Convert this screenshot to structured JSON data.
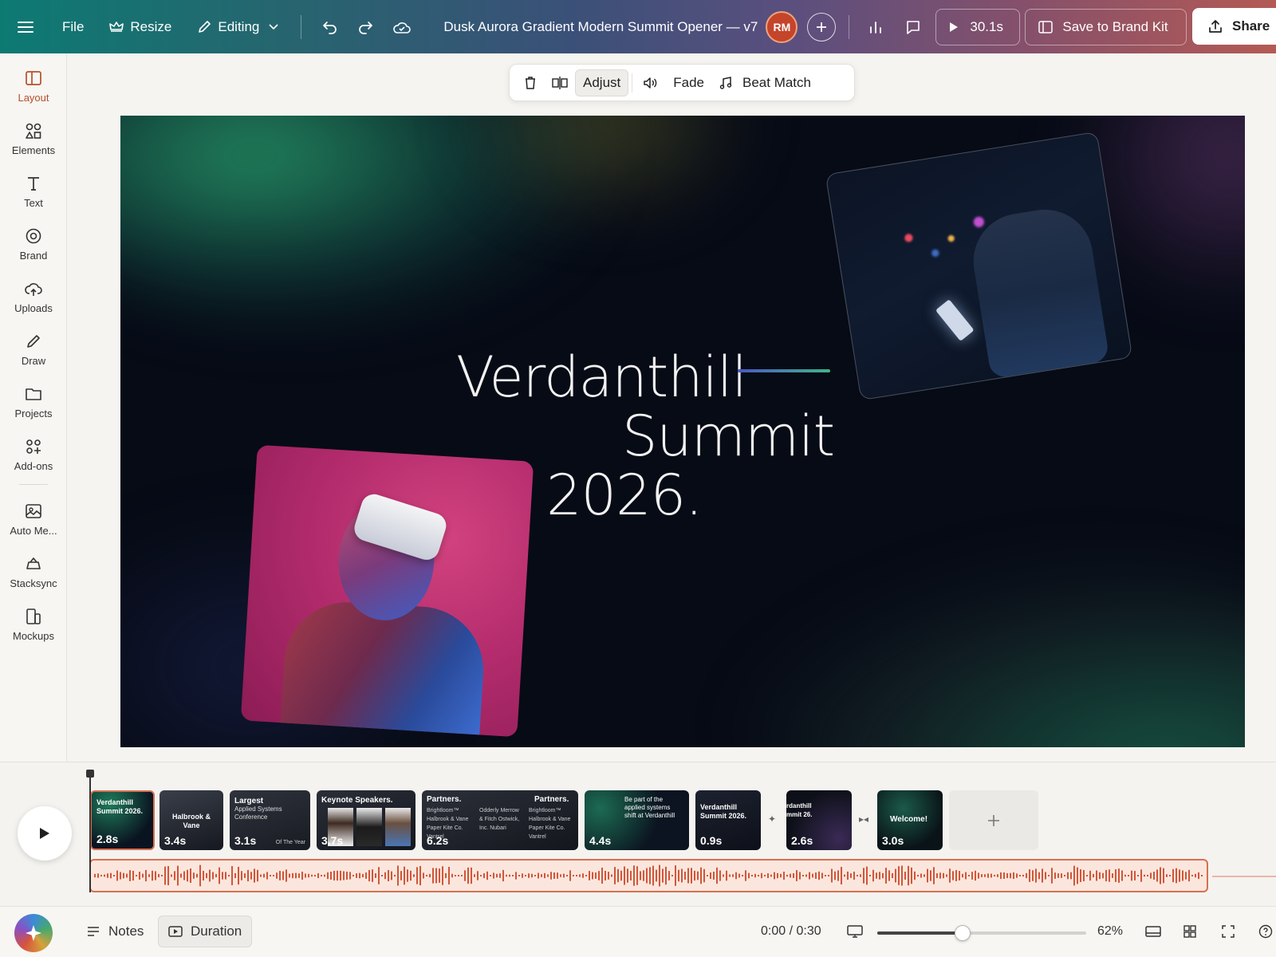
{
  "topbar": {
    "file": "File",
    "resize": "Resize",
    "editing": "Editing",
    "doc_title": "Dusk Aurora Gradient Modern Summit Opener — v7",
    "avatar_initials": "RM",
    "play_duration": "30.1s",
    "save_brand": "Save to Brand Kit",
    "share": "Share"
  },
  "sidebar": {
    "items": [
      {
        "label": "Layout",
        "icon": "layout-icon"
      },
      {
        "label": "Elements",
        "icon": "elements-icon"
      },
      {
        "label": "Text",
        "icon": "text-icon"
      },
      {
        "label": "Brand",
        "icon": "brand-icon"
      },
      {
        "label": "Uploads",
        "icon": "upload-cloud-icon"
      },
      {
        "label": "Draw",
        "icon": "pencil-icon"
      },
      {
        "label": "Projects",
        "icon": "folder-icon"
      },
      {
        "label": "Add-ons",
        "icon": "addons-icon"
      },
      {
        "label": "Auto Me...",
        "icon": "image-icon"
      },
      {
        "label": "Stacksync",
        "icon": "stack-icon"
      },
      {
        "label": "Mockups",
        "icon": "mockups-icon"
      }
    ]
  },
  "context_toolbar": {
    "adjust": "Adjust",
    "fade": "Fade",
    "beat_match": "Beat Match"
  },
  "slide": {
    "line1": "Verdanthill",
    "line2": "Summit",
    "line3": "2026.",
    "accent_colors": [
      "#4a57c4",
      "#3fb58a"
    ]
  },
  "timeline": {
    "clips": [
      {
        "title": "Verdanthill Summit 2026.",
        "duration": "2.8s"
      },
      {
        "title": "Halbrook & Vane",
        "duration": "3.4s"
      },
      {
        "title": "Largest",
        "subtitle": "Applied Systems Conference",
        "footer": "Of The Year",
        "duration": "3.1s"
      },
      {
        "title": "Keynote Speakers.",
        "duration": "3.7s"
      },
      {
        "title": "Partners.",
        "title2": "Partners.",
        "col1": "Brightloom™ Halbrook & Vane Paper Kite Co. Vantrel",
        "col2": "Odderly Merrow & Fitch Ostwick, Inc. Nubari",
        "col3": "Brightloom™ Halbrook & Vane Paper Kite Co. Vantrel",
        "duration": "6.2s"
      },
      {
        "title": "Be part of the applied systems shift at Verdanthill",
        "duration": "4.4s"
      },
      {
        "title": "Verdanthill Summit 2026.",
        "duration": "0.9s"
      },
      {
        "title": "rdanthill mmit 26.",
        "duration": "2.6s"
      },
      {
        "title": "Welcome!",
        "duration": "3.0s"
      }
    ]
  },
  "bottombar": {
    "notes": "Notes",
    "duration": "Duration",
    "time": "0:00 / 0:30",
    "zoom": "62%",
    "zoom_level": 0.41
  }
}
